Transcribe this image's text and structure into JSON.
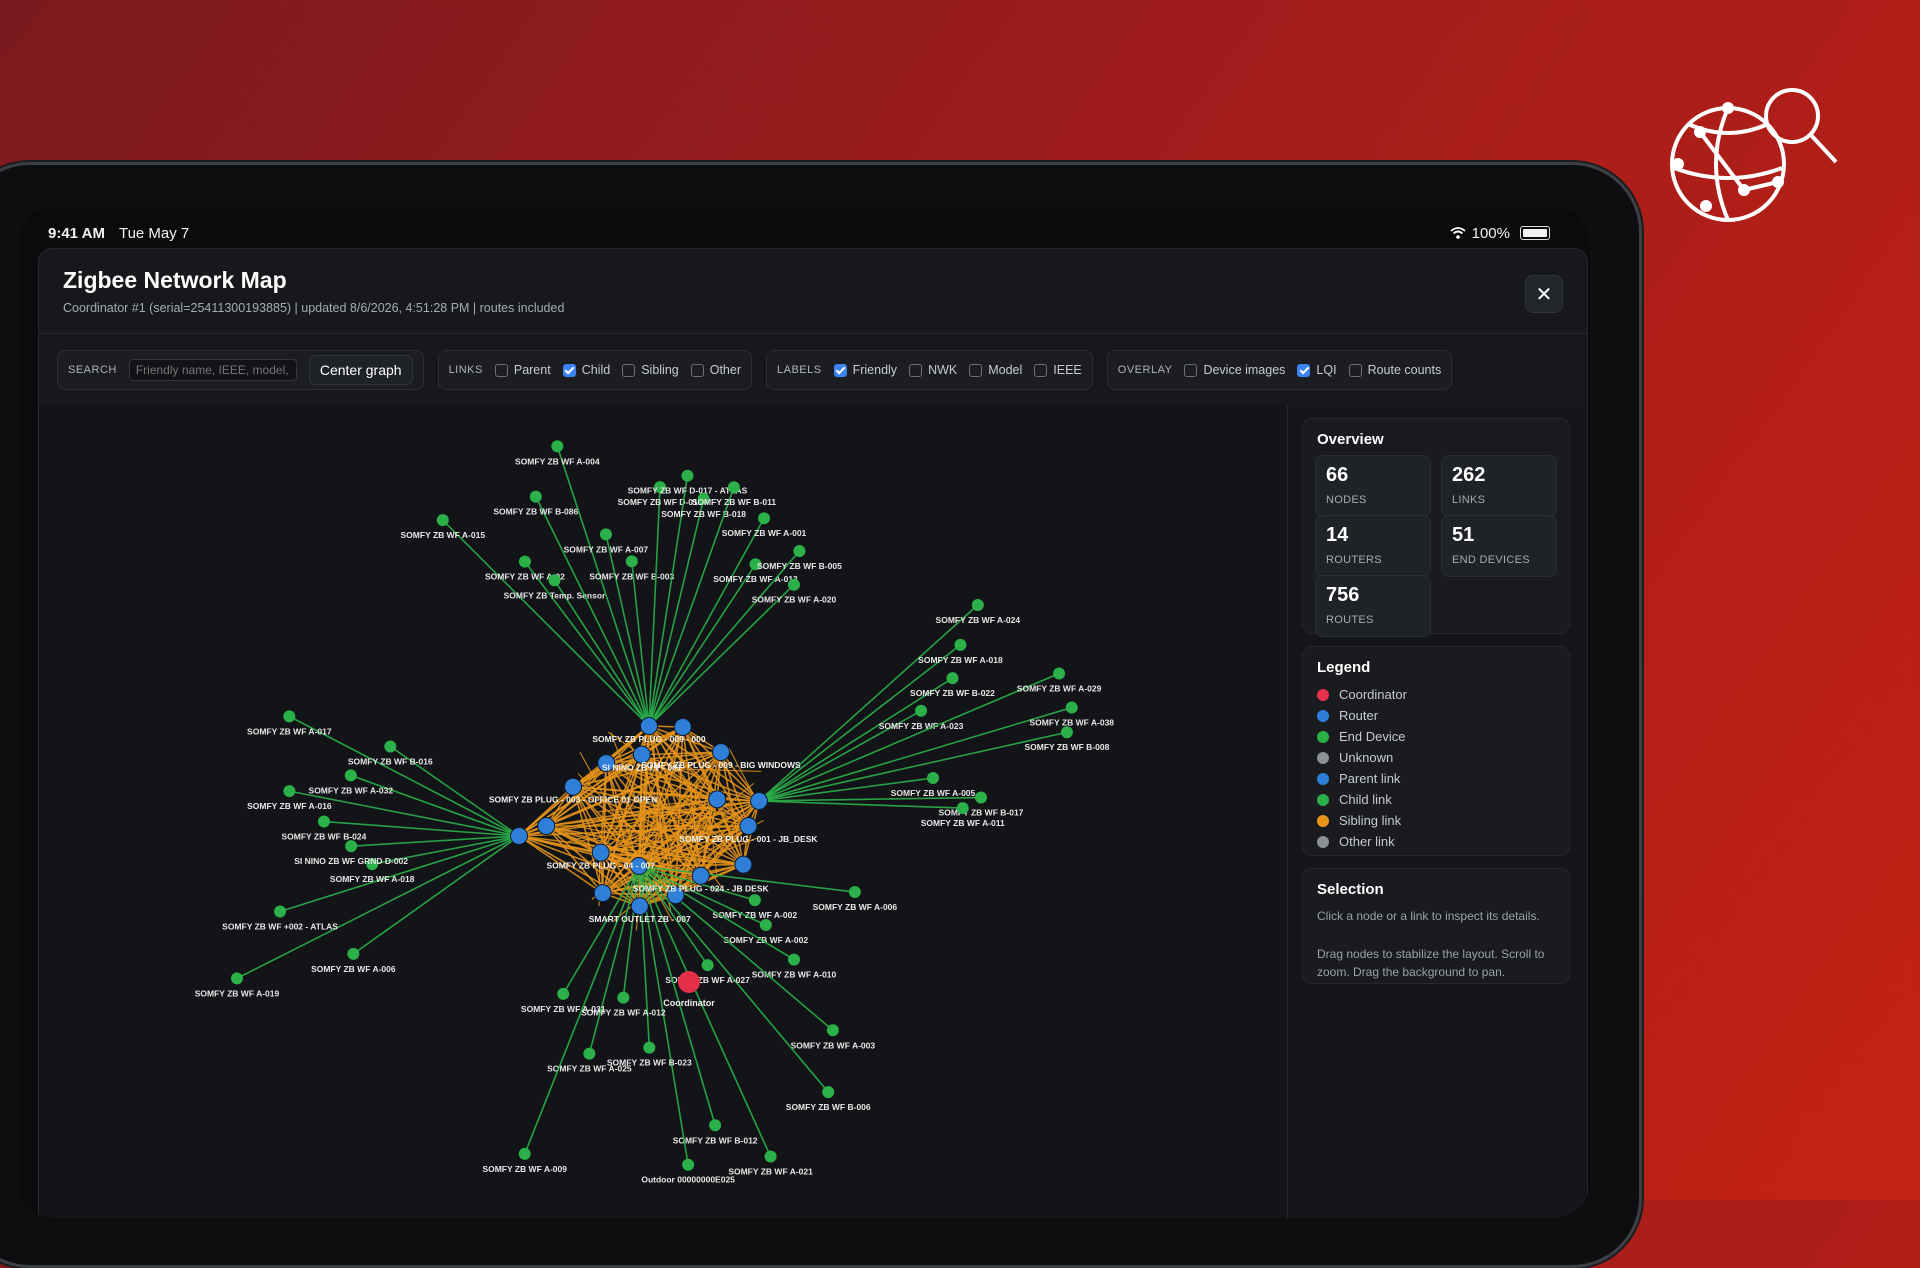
{
  "status_bar": {
    "time": "9:41 AM",
    "date": "Tue May 7",
    "battery": "100%"
  },
  "header": {
    "title": "Zigbee Network Map",
    "subtitle": "Coordinator #1 (serial=25411300193885) | updated 8/6/2026, 4:51:28 PM | routes included"
  },
  "toolbar": {
    "search_label": "SEARCH",
    "search_placeholder": "Friendly name, IEEE, model,",
    "center_button": "Center graph",
    "links": {
      "label": "LINKS",
      "parent": "Parent",
      "child": "Child",
      "sibling": "Sibling",
      "other": "Other"
    },
    "labels": {
      "label": "LABELS",
      "friendly": "Friendly",
      "nwk": "NWK",
      "model": "Model",
      "ieee": "IEEE"
    },
    "overlay": {
      "label": "OVERLAY",
      "device_images": "Device images",
      "lqi": "LQI",
      "route_counts": "Route counts"
    }
  },
  "overview": {
    "title": "Overview",
    "nodes": {
      "value": "66",
      "label": "NODES"
    },
    "links": {
      "value": "262",
      "label": "LINKS"
    },
    "routers": {
      "value": "14",
      "label": "ROUTERS"
    },
    "end_devices": {
      "value": "51",
      "label": "END DEVICES"
    },
    "routes": {
      "value": "756",
      "label": "ROUTES"
    }
  },
  "legend": {
    "title": "Legend",
    "items": [
      {
        "label": "Coordinator",
        "color": "#e5304a"
      },
      {
        "label": "Router",
        "color": "#2f7fd8"
      },
      {
        "label": "End Device",
        "color": "#2bb04a"
      },
      {
        "label": "Unknown",
        "color": "#8c9097"
      },
      {
        "label": "Parent link",
        "color": "#2f7fd8"
      },
      {
        "label": "Child link",
        "color": "#2bb04a"
      },
      {
        "label": "Sibling link",
        "color": "#e8951a"
      },
      {
        "label": "Other link",
        "color": "#8c9097"
      }
    ]
  },
  "selection": {
    "title": "Selection",
    "text1": "Click a node or a link to inspect its details.",
    "text2": "Drag nodes to stabilize the layout. Scroll to zoom. Drag the background to pan."
  },
  "graph": {
    "hubs": {
      "top": [
        "SOMFY ZB WF A-015",
        "SOMFY ZB WF A-02",
        "SOMFY ZB Temp. Sensor",
        "SOMFY ZB WF B-086",
        "SOMFY ZB WF A-004",
        "SOMFY ZB WF A-007",
        "SOMFY ZB WF B-003",
        "SOMFY ZB WF D-013",
        "SOMFY ZB WF D-017 - ATLAS",
        "SOMFY ZB WF B-018",
        "SOMFY ZB WF B-011",
        "SOMFY ZB WF A-001",
        "SOMFY ZB WF A-013",
        "SOMFY ZB WF B-005",
        "SOMFY ZB WF A-020"
      ],
      "right": [
        "SOMFY ZB WF A-024",
        "SOMFY ZB WF A-018",
        "SOMFY ZB WF B-022",
        "SOMFY ZB WF A-023",
        "SOMFY ZB WF A-029",
        "SOMFY ZB WF A-038",
        "SOMFY ZB WF B-008",
        "SOMFY ZB WF A-005",
        "SOMFY ZB WF B-017",
        "SOMFY ZB WF A-011"
      ],
      "left": [
        "SOMFY ZB WF A-006",
        "SOMFY ZB WF A-019",
        "SOMFY ZB WF +002 - ATLAS",
        "SOMFY ZB WF A-018",
        "SI NINO ZB WF GRND D-002",
        "SOMFY ZB WF B-024",
        "SOMFY ZB WF A-016",
        "SOMFY ZB WF A-032",
        "SOMFY ZB WF A-017",
        "SOMFY ZB WF B-016"
      ],
      "bottom": [
        "SOMFY ZB WF A-006",
        "SOMFY ZB WF A-002",
        "SOMFY ZB WF A-002",
        "SOMFY ZB WF A-010",
        "SOMFY ZB WF A-003",
        "SOMFY ZB WF B-006",
        "SOMFY ZB WF A-027",
        "SOMFY ZB WF A-021",
        "SOMFY ZB WF B-012",
        "Outdoor 00000000E025",
        "SOMFY ZB WF B-023",
        "SOMFY ZB WF A-012",
        "SOMFY ZB WF A-025",
        "SOMFY ZB WF A-009",
        "SOMFY ZB WF A-031"
      ]
    },
    "router_labels": [
      "SOMFY ZB PLUG - 001 - JB_DESK",
      "SOMFY ZB PLUG - 024 - JB DESK",
      "SMART OUTLET ZB - 007",
      "SOMFY ZB PLUG - 04 - 007",
      "SOMFY ZB PLUG - 003 - OFFICE 01 OPEN",
      "SI NINO ZB LV - 001",
      "SOMFY ZB PLUG - 009 - BIG WINDOWS",
      "SOMFY ZB PLUG - 009 - 000"
    ],
    "coordinator_label": "Coordinator"
  }
}
